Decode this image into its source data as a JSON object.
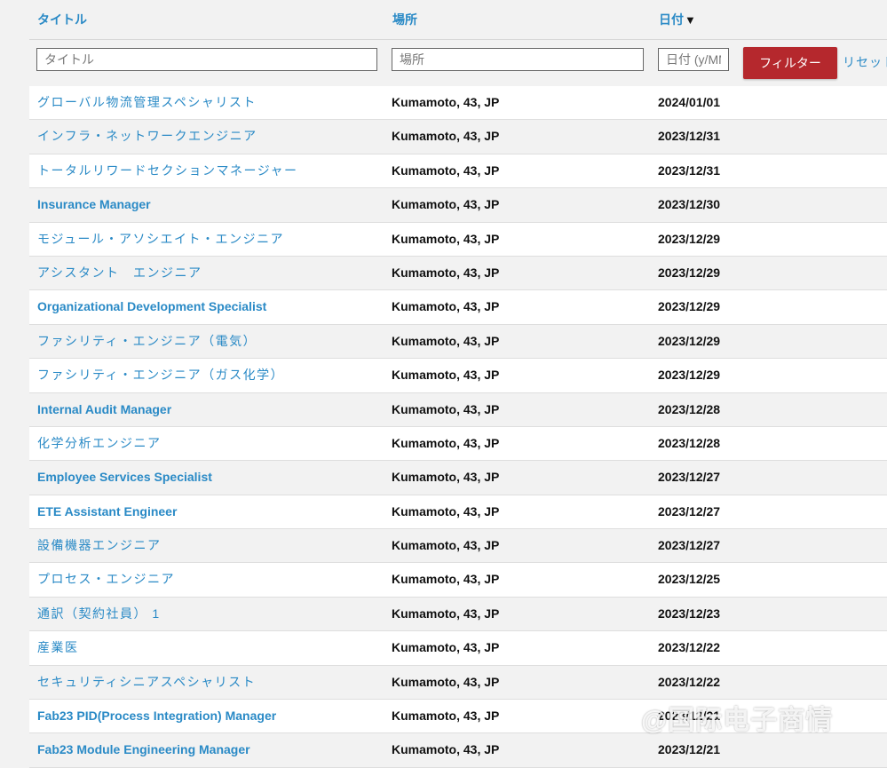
{
  "headers": {
    "title": "タイトル",
    "location": "場所",
    "date": "日付",
    "sort_arrow": "▼"
  },
  "filters": {
    "title_placeholder": "タイトル",
    "location_placeholder": "場所",
    "date_placeholder": "日付 (y/MM/dd)",
    "filter_button": "フィルター",
    "reset_link": "リセット"
  },
  "rows": [
    {
      "title": "グローバル物流管理スペシャリスト",
      "location": "Kumamoto, 43, JP",
      "date": "2024/01/01"
    },
    {
      "title": "インフラ・ネットワークエンジニア",
      "location": "Kumamoto, 43, JP",
      "date": "2023/12/31"
    },
    {
      "title": "トータルリワードセクションマネージャー",
      "location": "Kumamoto, 43, JP",
      "date": "2023/12/31"
    },
    {
      "title": "Insurance Manager",
      "location": "Kumamoto, 43, JP",
      "date": "2023/12/30"
    },
    {
      "title": "モジュール・アソシエイト・エンジニア",
      "location": "Kumamoto, 43, JP",
      "date": "2023/12/29"
    },
    {
      "title": "アシスタント　エンジニア",
      "location": "Kumamoto, 43, JP",
      "date": "2023/12/29"
    },
    {
      "title": "Organizational Development Specialist",
      "location": "Kumamoto, 43, JP",
      "date": "2023/12/29"
    },
    {
      "title": "ファシリティ・エンジニア（電気）",
      "location": "Kumamoto, 43, JP",
      "date": "2023/12/29"
    },
    {
      "title": "ファシリティ・エンジニア（ガス化学）",
      "location": "Kumamoto, 43, JP",
      "date": "2023/12/29"
    },
    {
      "title": "Internal Audit Manager",
      "location": "Kumamoto, 43, JP",
      "date": "2023/12/28"
    },
    {
      "title": "化学分析エンジニア",
      "location": "Kumamoto, 43, JP",
      "date": "2023/12/28"
    },
    {
      "title": "Employee Services Specialist",
      "location": "Kumamoto, 43, JP",
      "date": "2023/12/27"
    },
    {
      "title": "ETE Assistant Engineer",
      "location": "Kumamoto, 43, JP",
      "date": "2023/12/27"
    },
    {
      "title": "設備機器エンジニア",
      "location": "Kumamoto, 43, JP",
      "date": "2023/12/27"
    },
    {
      "title": "プロセス・エンジニア",
      "location": "Kumamoto, 43, JP",
      "date": "2023/12/25"
    },
    {
      "title": "通訳（契約社員） 1",
      "location": "Kumamoto, 43, JP",
      "date": "2023/12/23"
    },
    {
      "title": "産業医",
      "location": "Kumamoto, 43, JP",
      "date": "2023/12/22"
    },
    {
      "title": "セキュリティシニアスペシャリスト",
      "location": "Kumamoto, 43, JP",
      "date": "2023/12/22"
    },
    {
      "title": "Fab23 PID(Process Integration) Manager",
      "location": "Kumamoto, 43, JP",
      "date": "2023/12/21"
    },
    {
      "title": "Fab23 Module Engineering Manager",
      "location": "Kumamoto, 43, JP",
      "date": "2023/12/21"
    }
  ],
  "watermark": "@国际电子商情"
}
